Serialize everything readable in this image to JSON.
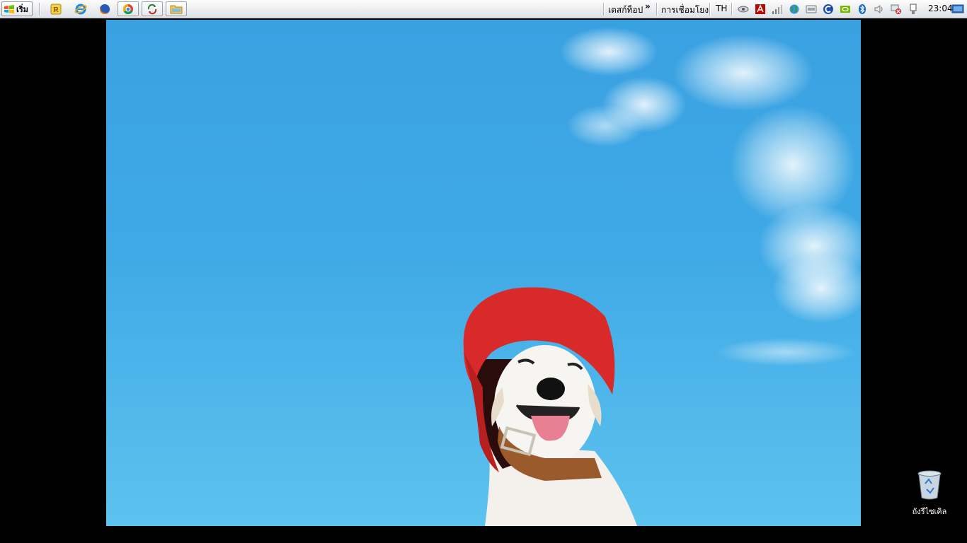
{
  "taskbar": {
    "start_label": "เริ่ม",
    "quicklaunch": [
      {
        "name": "r-app-icon"
      },
      {
        "name": "internet-explorer-icon"
      },
      {
        "name": "firefox-icon"
      },
      {
        "name": "chrome-icon"
      },
      {
        "name": "sync-icon"
      },
      {
        "name": "folder-icon"
      }
    ],
    "desktop_toolbar_label": "เดสก์ท็อป",
    "overflow_chevron": "»",
    "links_label": "การเชื่อมโยง",
    "language": "TH",
    "tray_icons": [
      "eye-icon",
      "adobe-icon",
      "signal-bars-icon",
      "globe-icon",
      "storage-icon",
      "c-app-icon",
      "nvidia-icon",
      "bluetooth-icon",
      "volume-icon",
      "network-error-icon",
      "usb-icon"
    ],
    "clock": "23:04",
    "show_desktop_icon": "show-desktop-icon"
  },
  "desktop": {
    "recycle_bin_label": "ถังรีไซเคิล"
  },
  "colors": {
    "sky": "#3fa9e6",
    "cap_red": "#d92a2a",
    "collar_brown": "#9a5a2c"
  }
}
